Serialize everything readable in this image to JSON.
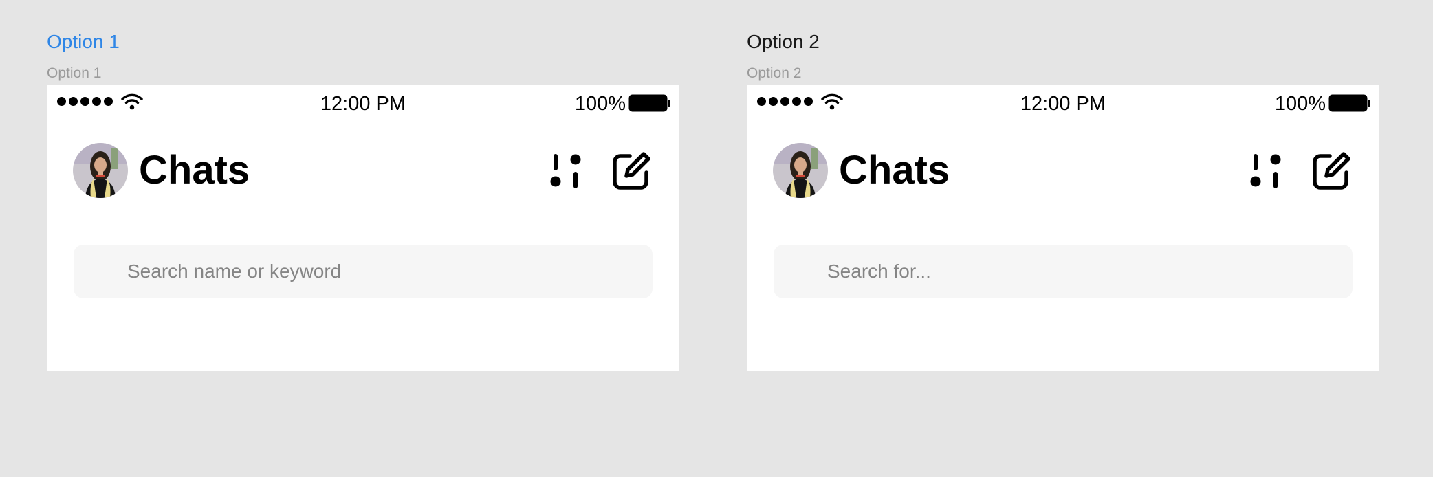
{
  "options": [
    {
      "tab_label": "Option 1",
      "frame_label": "Option 1",
      "status_bar": {
        "time": "12:00 PM",
        "battery": "100%"
      },
      "header": {
        "title": "Chats"
      },
      "search": {
        "placeholder": "Search name or keyword",
        "value": ""
      }
    },
    {
      "tab_label": "Option 2",
      "frame_label": "Option 2",
      "status_bar": {
        "time": "12:00 PM",
        "battery": "100%"
      },
      "header": {
        "title": "Chats"
      },
      "search": {
        "placeholder": "Search for...",
        "value": ""
      }
    }
  ],
  "colors": {
    "background": "#e5e5e5",
    "active_tab": "#2f86e6",
    "frame_label": "#9a9a9a",
    "search_bg": "#f6f6f6",
    "placeholder": "#858585"
  },
  "icons": {
    "signal": "cellular-signal-icon",
    "wifi": "wifi-icon",
    "battery": "battery-icon",
    "filter": "filter-icon",
    "compose": "compose-icon"
  }
}
